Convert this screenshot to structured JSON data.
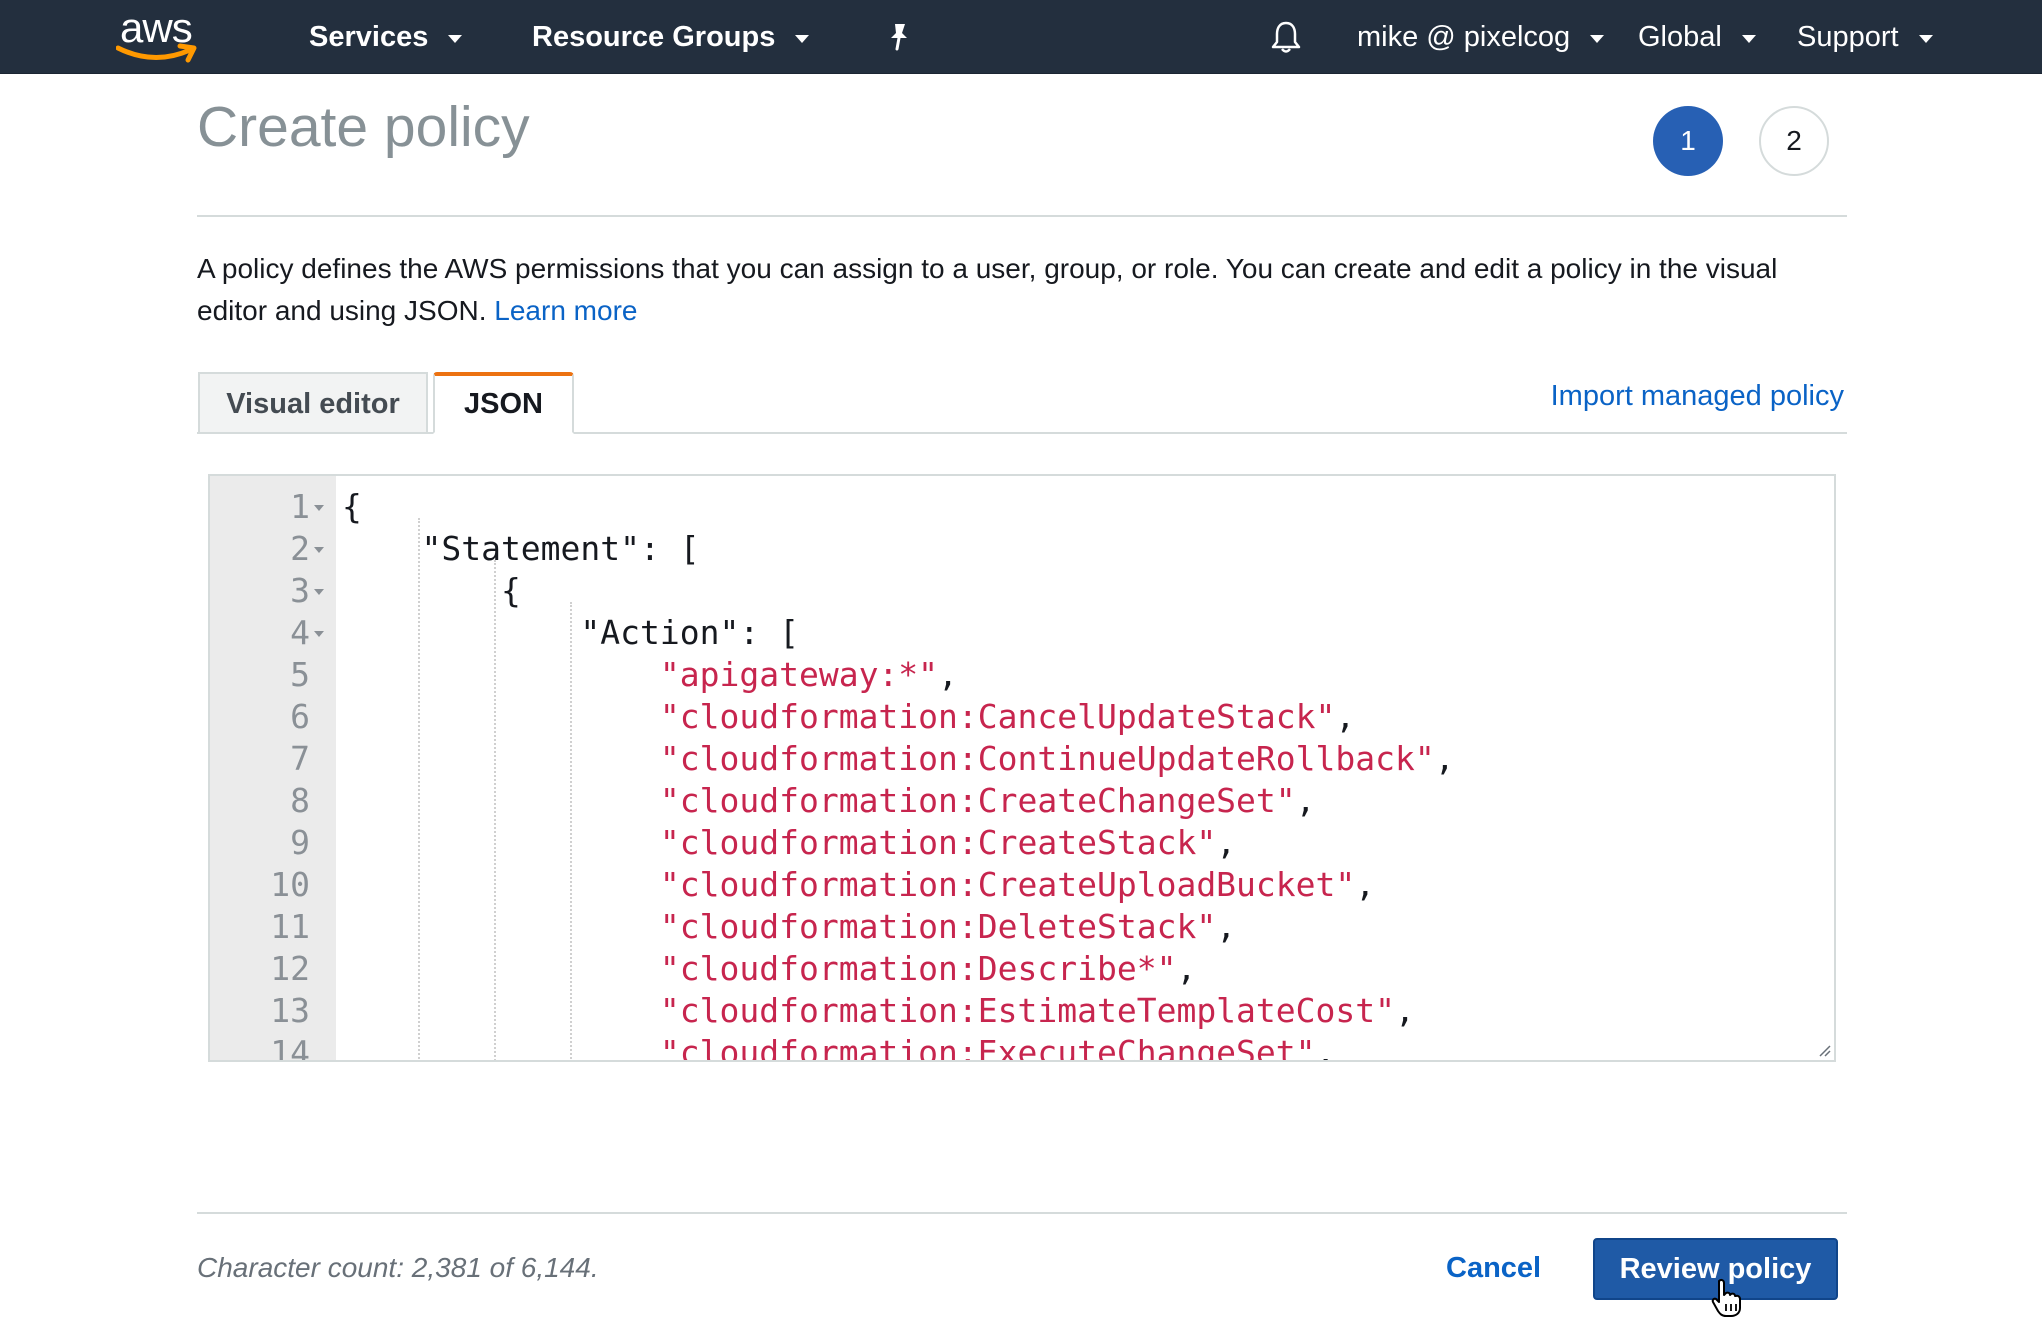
{
  "topnav": {
    "logo_text": "aws",
    "services_label": "Services",
    "resource_groups_label": "Resource Groups",
    "pin_icon": "pin-icon",
    "bell_icon": "bell-icon",
    "account_label": "mike @ pixelcog",
    "region_label": "Global",
    "support_label": "Support",
    "background_color": "#232f3e",
    "logo_smile_color": "#ff9900"
  },
  "header": {
    "title": "Create policy",
    "steps": [
      "1",
      "2"
    ],
    "active_step": "1"
  },
  "description": {
    "text": "A policy defines the AWS permissions that you can assign to a user, group, or role. You can create and edit a policy in the visual editor and using JSON.",
    "learn_more": "Learn more"
  },
  "tabs": {
    "visual_editor": "Visual editor",
    "json": "JSON",
    "active": "JSON",
    "import_link": "Import managed policy"
  },
  "editor": {
    "lines": [
      {
        "n": "1",
        "text": "{",
        "fold": true
      },
      {
        "n": "2",
        "text": "    \"Statement\": [",
        "fold": true
      },
      {
        "n": "3",
        "text": "        {",
        "fold": true
      },
      {
        "n": "4",
        "text": "            \"Action\": [",
        "fold": true
      },
      {
        "n": "5",
        "text": "\"apigateway:*\"",
        "fold": false
      },
      {
        "n": "6",
        "text": "\"cloudformation:CancelUpdateStack\"",
        "fold": false
      },
      {
        "n": "7",
        "text": "\"cloudformation:ContinueUpdateRollback\"",
        "fold": false
      },
      {
        "n": "8",
        "text": "\"cloudformation:CreateChangeSet\"",
        "fold": false
      },
      {
        "n": "9",
        "text": "\"cloudformation:CreateStack\"",
        "fold": false
      },
      {
        "n": "10",
        "text": "\"cloudformation:CreateUploadBucket\"",
        "fold": false
      },
      {
        "n": "11",
        "text": "\"cloudformation:DeleteStack\"",
        "fold": false
      },
      {
        "n": "12",
        "text": "\"cloudformation:Describe*\"",
        "fold": false
      },
      {
        "n": "13",
        "text": "\"cloudformation:EstimateTemplateCost\"",
        "fold": false
      },
      {
        "n": "14",
        "text": "\"cloudformation:ExecuteChangeSet\"",
        "fold": false
      }
    ],
    "string_color": "#c7254e"
  },
  "footer": {
    "char_count": "Character count: 2,381 of 6,144.",
    "cancel_label": "Cancel",
    "review_label": "Review policy",
    "primary_color": "#1f5aa6"
  }
}
